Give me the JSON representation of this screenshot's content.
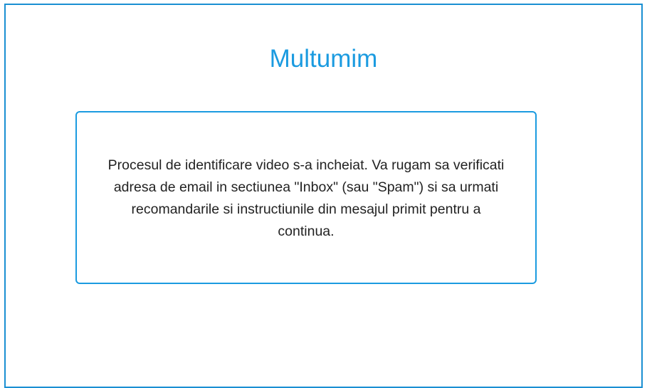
{
  "page": {
    "title": "Multumim",
    "message": "Procesul de identificare video s-a incheiat. Va rugam sa verificati adresa de email in sectiunea \"Inbox\" (sau \"Spam\") si sa urmati recomandarile si instructiunile din mesajul primit pentru a continua."
  },
  "colors": {
    "accent": "#1b9be0",
    "frame_border": "#1a8fd2",
    "text": "#222222",
    "background": "#ffffff"
  }
}
